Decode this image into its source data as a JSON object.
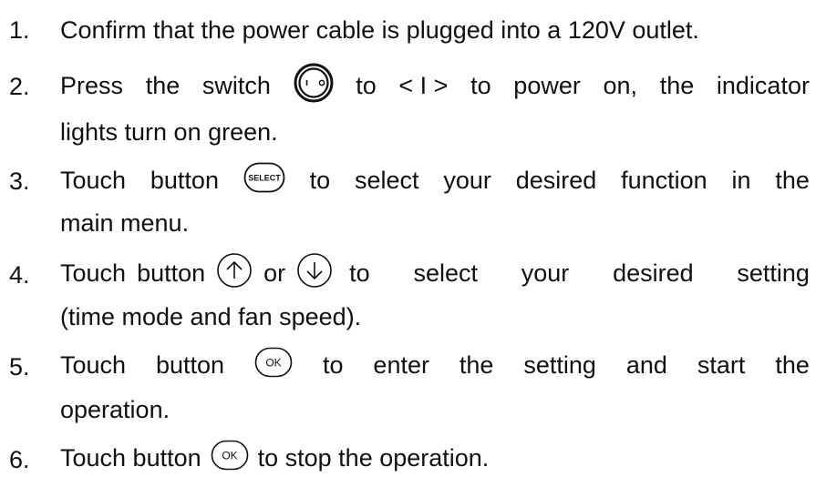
{
  "steps": [
    {
      "num": "1.",
      "line1": "Confirm that the power cable is plugged into a 120V outlet."
    },
    {
      "num": "2.",
      "l1_a": "Press",
      "l1_b": "the",
      "l1_c": "switch",
      "l1_d": "to",
      "l1_e": "< I >",
      "l1_f": "to",
      "l1_g": "power",
      "l1_h": "on,",
      "l1_i": "the",
      "l1_j": "indicator",
      "line2": "lights turn on green.",
      "icon": "power-switch-icon"
    },
    {
      "num": "3.",
      "l1_a": "Touch",
      "l1_b": "button",
      "l1_c": "to",
      "l1_d": "select",
      "l1_e": "your",
      "l1_f": "desired",
      "l1_g": "function",
      "l1_h": "in",
      "l1_i": "the",
      "line2": "main menu.",
      "icon": "select-button-icon",
      "icon_text": "SELECT"
    },
    {
      "num": "4.",
      "l1_a": "Touch",
      "l1_b": "button",
      "l1_c": "or",
      "l1_d": "to",
      "l1_e": "select",
      "l1_f": "your",
      "l1_g": "desired",
      "l1_h": "setting",
      "line2": "(time mode and fan speed).",
      "icons": [
        "up-arrow-button-icon",
        "down-arrow-button-icon"
      ]
    },
    {
      "num": "5.",
      "l1_a": "Touch",
      "l1_b": "button",
      "l1_c": "to",
      "l1_d": "enter",
      "l1_e": "the",
      "l1_f": "setting",
      "l1_g": "and",
      "l1_h": "start",
      "l1_i": "the",
      "line2": "operation.",
      "icon": "ok-button-icon",
      "icon_text": "OK"
    },
    {
      "num": "6.",
      "l1_a": "Touch button",
      "l1_b": "to stop the operation.",
      "icon": "ok-button-icon",
      "icon_text": "OK"
    }
  ]
}
